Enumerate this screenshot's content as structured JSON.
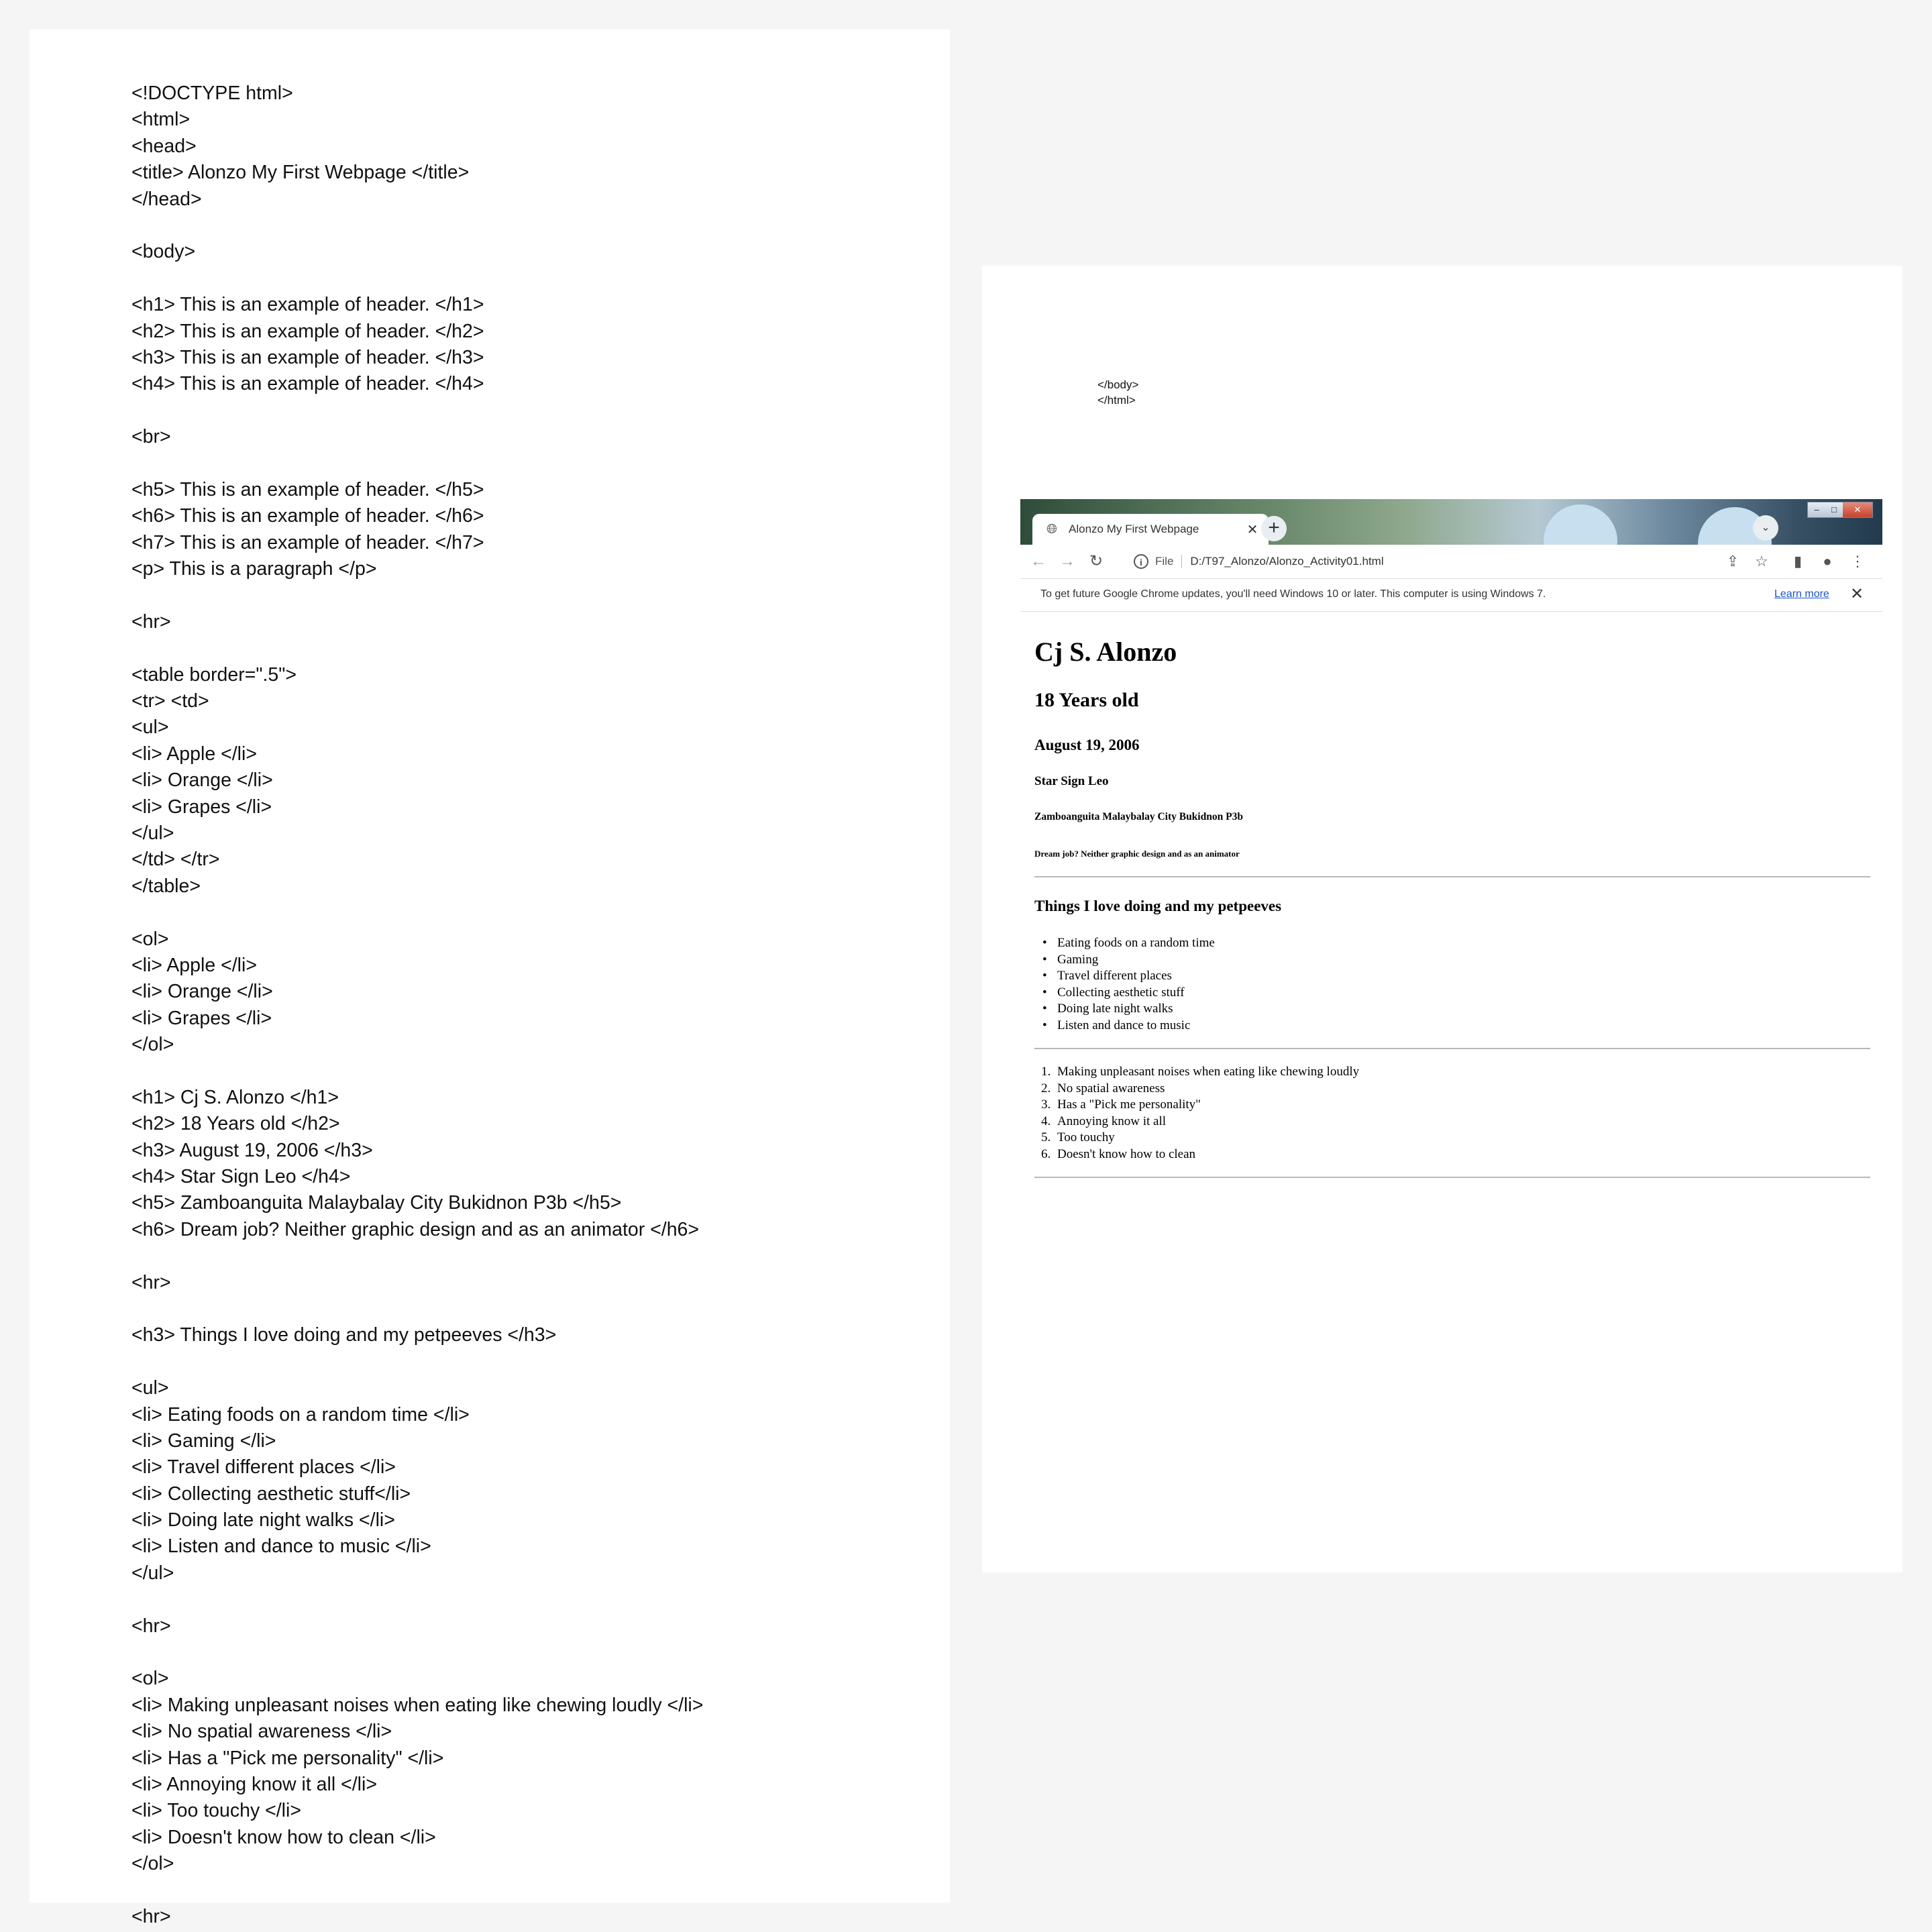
{
  "source_code": {
    "lines": [
      "<!DOCTYPE html>",
      "<html>",
      "<head>",
      "<title> Alonzo My First Webpage </title>",
      "</head>",
      "",
      "<body>",
      "",
      "<h1> This is an example of header. </h1>",
      "<h2> This is an example of header. </h2>",
      "<h3> This is an example of header. </h3>",
      "<h4> This is an example of header. </h4>",
      "",
      "<br>",
      "",
      "<h5> This is an example of header. </h5>",
      "<h6> This is an example of header. </h6>",
      "<h7> This is an example of header. </h7>",
      "<p> This is a paragraph </p>",
      "",
      "<hr>",
      "",
      "<table border=\".5\">",
      "<tr> <td>",
      "<ul>",
      "<li> Apple </li>",
      "<li> Orange </li>",
      "<li> Grapes </li>",
      "</ul>",
      "</td> </tr>",
      "</table>",
      "",
      "<ol>",
      "<li> Apple </li>",
      "<li> Orange </li>",
      "<li> Grapes </li>",
      "</ol>",
      "",
      "<h1> Cj S. Alonzo </h1>",
      "<h2> 18 Years old </h2>",
      "<h3> August 19, 2006 </h3>",
      "<h4> Star Sign Leo </h4>",
      "<h5> Zamboanguita Malaybalay City Bukidnon P3b </h5>",
      "<h6> Dream job? Neither graphic design and as an animator </h6>",
      "",
      "<hr>",
      "",
      "<h3> Things I love doing and my petpeeves </h3>",
      "",
      "<ul>",
      "<li> Eating foods on a random time </li>",
      "<li> Gaming </li>",
      "<li> Travel different places </li>",
      "<li> Collecting aesthetic stuff</li>",
      "<li> Doing late night walks </li>",
      "<li> Listen and dance to music </li>",
      "</ul>",
      "",
      "<hr>",
      "",
      "<ol>",
      "<li> Making unpleasant noises when eating like chewing loudly </li>",
      "<li> No spatial awareness </li>",
      "<li> Has a \"Pick me personality\" </li>",
      "<li> Annoying know it all </li>",
      "<li> Too touchy </li>",
      "<li> Doesn't know how to clean </li>",
      "</ol>",
      "",
      "<hr>"
    ],
    "tail": [
      "</body>",
      "</html>"
    ]
  },
  "browser": {
    "tab_title": "Alonzo My First Webpage",
    "tab_close": "✕",
    "new_tab": "+",
    "tab_search": "⌄",
    "window_controls": {
      "minimize": "–",
      "maximize": "□",
      "close": "✕"
    },
    "nav": {
      "back": "←",
      "forward": "→",
      "reload": "↻"
    },
    "omnibox": {
      "scheme": "File",
      "url": "D:/T97_Alonzo/Alonzo_Activity01.html"
    },
    "toolbar_icons": {
      "share": "⇪",
      "bookmark": "☆",
      "sidepanel": "▮",
      "profile": "●",
      "menu": "⋮"
    },
    "infobar": {
      "message": "To get future Google Chrome updates, you'll need Windows 10 or later. This computer is using Windows 7.",
      "link": "Learn more",
      "close": "✕"
    },
    "page": {
      "h1": "Cj S. Alonzo",
      "h2": "18 Years old",
      "h3": "August 19, 2006",
      "h4": "Star Sign Leo",
      "h5": "Zamboanguita Malaybalay City Bukidnon P3b",
      "h6": "Dream job? Neither graphic design and as an animator",
      "section_title": "Things I love doing and my petpeeves",
      "loves": [
        "Eating foods on a random time",
        "Gaming",
        "Travel different places",
        "Collecting aesthetic stuff",
        "Doing late night walks",
        "Listen and dance to music"
      ],
      "petpeeves": [
        "Making unpleasant noises when eating like chewing loudly",
        "No spatial awareness",
        "Has a \"Pick me personality\"",
        "Annoying know it all",
        "Too touchy",
        "Doesn't know how to clean"
      ]
    }
  }
}
